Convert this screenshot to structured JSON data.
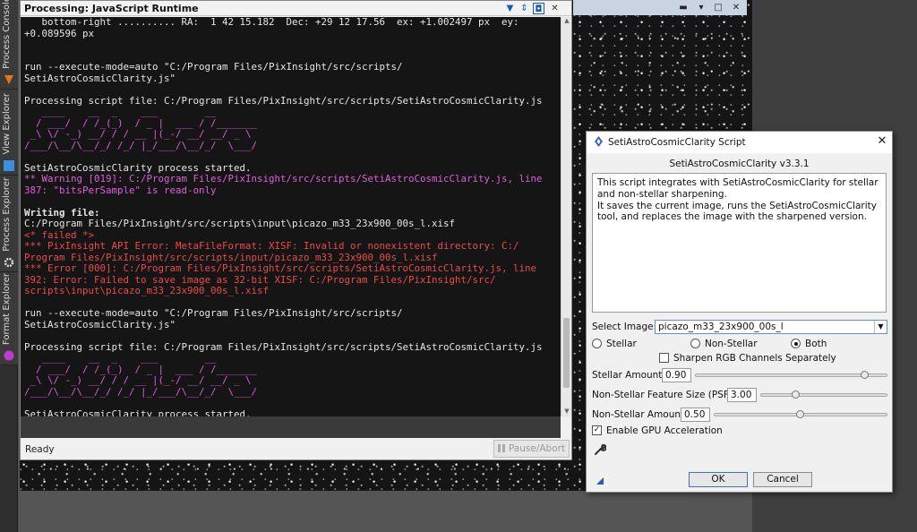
{
  "sidebar": {
    "tabs": [
      {
        "label": "Process Console"
      },
      {
        "label": "View Explorer"
      },
      {
        "label": "Process Explorer"
      },
      {
        "label": "Format Explorer"
      }
    ]
  },
  "console": {
    "title": "Processing: JavaScript Runtime",
    "status": "Ready",
    "pause_label": "Pause/Abort",
    "lines": [
      {
        "text": "   bottom-right .......... RA:  1 42 15.182  Dec: +29 12 17.56  ex: +1.002497 px  ey:",
        "style": ""
      },
      {
        "text": "+0.089596 px",
        "style": ""
      },
      {
        "text": "",
        "style": ""
      },
      {
        "text": "",
        "style": ""
      },
      {
        "text": "run --execute-mode=auto \"C:/Program Files/PixInsight/src/scripts/",
        "style": ""
      },
      {
        "text": "SetiAstroCosmicClarity.js\"",
        "style": ""
      },
      {
        "text": "",
        "style": ""
      },
      {
        "text": "Processing script file: C:/Program Files/PixInsight/src/scripts/SetiAstroCosmicClarity.js",
        "style": ""
      },
      {
        "text": "   ____    __  _    ___        __",
        "style": "magenta"
      },
      {
        "text": "  / ___/  / /_(_)  / _ |  ___ / /_______",
        "style": "magenta"
      },
      {
        "text": " _\\ \\/ -_) __/ / / __ |(_-/ __/ __/ _ \\",
        "style": "magenta"
      },
      {
        "text": "/___/\\__/\\__/_/ /_/ |_/___/\\__/_/  \\___/",
        "style": "magenta"
      },
      {
        "text": "",
        "style": ""
      },
      {
        "text": "SetiAstroCosmicClarity process started.",
        "style": ""
      },
      {
        "text": "** Warning [019]: C:/Program Files/PixInsight/src/scripts/SetiAstroCosmicClarity.js, line",
        "style": "magenta"
      },
      {
        "text": "387: \"bitsPerSample\" is read-only",
        "style": "magenta"
      },
      {
        "text": "",
        "style": ""
      },
      {
        "text": "Writing file:",
        "style": "bold"
      },
      {
        "text": "C:/Program Files/PixInsight/src/scripts\\input\\picazo_m33_23x900_00s_l.xisf",
        "style": ""
      },
      {
        "text": "<* failed *>",
        "style": "red"
      },
      {
        "text": "*** PixInsight API Error: MetaFileFormat: XISF: Invalid or nonexistent directory: C:/",
        "style": "red"
      },
      {
        "text": "Program Files/PixInsight/src/scripts/input/picazo_m33_23x900_00s_l.xisf",
        "style": "red"
      },
      {
        "text": "*** Error [000]: C:/Program Files/PixInsight/src/scripts/SetiAstroCosmicClarity.js, line",
        "style": "red"
      },
      {
        "text": "392: Error: Failed to save image as 32-bit XISF: C:/Program Files/PixInsight/src/",
        "style": "red"
      },
      {
        "text": "scripts\\input\\picazo_m33_23x900_00s_l.xisf",
        "style": "red"
      },
      {
        "text": "",
        "style": ""
      },
      {
        "text": "run --execute-mode=auto \"C:/Program Files/PixInsight/src/scripts/",
        "style": ""
      },
      {
        "text": "SetiAstroCosmicClarity.js\"",
        "style": ""
      },
      {
        "text": "",
        "style": ""
      },
      {
        "text": "Processing script file: C:/Program Files/PixInsight/src/scripts/SetiAstroCosmicClarity.js",
        "style": ""
      },
      {
        "text": "   ____    __  _    ___        __",
        "style": "magenta"
      },
      {
        "text": "  / ___/  / /_(_)  / _ |  ___ / /_______",
        "style": "magenta"
      },
      {
        "text": " _\\ \\/ -_) __/ / / __ |(_-/ __/ __/ _ \\",
        "style": "magenta"
      },
      {
        "text": "/___/\\__/\\__/_/ /_/ |_/___/\\__/_/  \\___/",
        "style": "magenta"
      },
      {
        "text": "",
        "style": ""
      },
      {
        "text": "SetiAstroCosmicClarity process started.",
        "style": ""
      }
    ]
  },
  "dialog": {
    "title": "SetiAstroCosmicClarity Script",
    "version": "SetiAstroCosmicClarity v3.3.1",
    "description": [
      "This script integrates with SetiAstroCosmicClarity for stellar",
      "and non-stellar sharpening.",
      "It saves the current image, runs the SetiAstroCosmicClarity",
      "tool, and replaces the image with the sharpened version."
    ],
    "select_image_label": "Select Image:",
    "select_image_value": "picazo_m33_23x900_00s_l",
    "mode_options": [
      {
        "label": "Stellar",
        "selected": false
      },
      {
        "label": "Non-Stellar",
        "selected": false
      },
      {
        "label": "Both",
        "selected": true
      }
    ],
    "sharpen_rgb_label": "Sharpen RGB Channels Separately",
    "sharpen_rgb_checked": false,
    "stellar_amount_label": "Stellar Amount:",
    "stellar_amount": "0.90",
    "psf_label": "Non-Stellar Feature Size (PSF):",
    "psf_value": "3.00",
    "nonstellar_amount_label": "Non-Stellar Amount:",
    "nonstellar_amount": "0.50",
    "gpu_label": "Enable GPU Acceleration",
    "gpu_checked": true,
    "ok_label": "OK",
    "cancel_label": "Cancel"
  }
}
